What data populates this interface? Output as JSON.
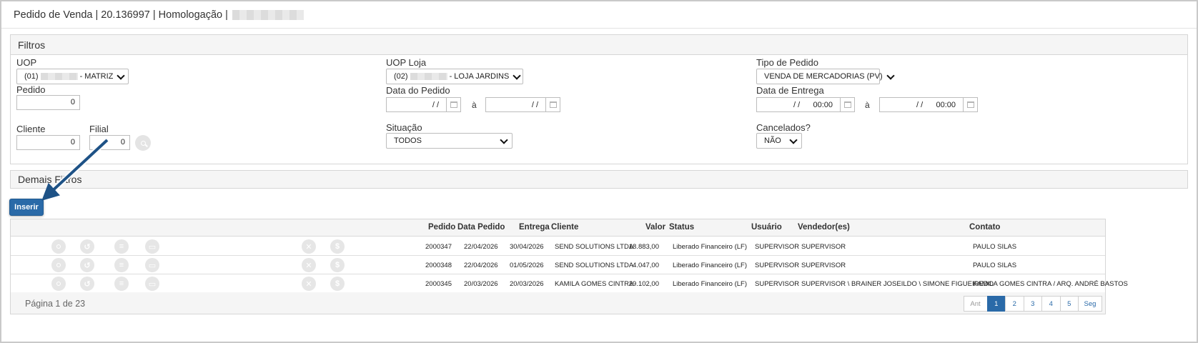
{
  "title": {
    "prefix": "Pedido de Venda | 20.136997 | Homologação |"
  },
  "filters": {
    "header": "Filtros",
    "uop": {
      "label": "UOP",
      "prefix": "(01)",
      "suffix": "- MATRIZ"
    },
    "uop_loja": {
      "label": "UOP Loja",
      "prefix": "(02)",
      "suffix": "- LOJA JARDINS"
    },
    "tipo_pedido": {
      "label": "Tipo de Pedido",
      "value": "VENDA DE MERCADORIAS (PV)"
    },
    "pedido": {
      "label": "Pedido",
      "value": "0"
    },
    "data_pedido": {
      "label": "Data do Pedido",
      "from": "/ /",
      "sep": "à",
      "to": "/ /"
    },
    "data_entrega": {
      "label": "Data de Entrega",
      "from": "/ /      00:00",
      "sep": "à",
      "to": "/ /      00:00"
    },
    "cliente": {
      "label": "Cliente",
      "value": "0"
    },
    "filial": {
      "label": "Filial",
      "value": "0"
    },
    "situacao": {
      "label": "Situação",
      "value": "TODOS"
    },
    "cancelados": {
      "label": "Cancelados?",
      "value": "NÃO"
    }
  },
  "demais_filtros": {
    "header": "Demais Filtros"
  },
  "actions": {
    "inserir": "Inserir"
  },
  "grid": {
    "columns": {
      "pedido": "Pedido",
      "data_pedido": "Data Pedido",
      "entrega": "Entrega",
      "cliente": "Cliente",
      "valor": "Valor",
      "status": "Status",
      "usuario": "Usuário",
      "vendedores": "Vendedor(es)",
      "contato": "Contato"
    },
    "rows": [
      {
        "pedido": "2000347",
        "data_pedido": "22/04/2026",
        "entrega": "30/04/2026",
        "cliente": "SEND SOLUTIONS LTDA",
        "valor": "18.883,00",
        "status": "Liberado Financeiro (LF)",
        "usuario": "SUPERVISOR",
        "vendedores": "SUPERVISOR",
        "contato": "PAULO SILAS"
      },
      {
        "pedido": "2000348",
        "data_pedido": "22/04/2026",
        "entrega": "01/05/2026",
        "cliente": "SEND SOLUTIONS LTDA",
        "valor": "4.047,00",
        "status": "Liberado Financeiro (LF)",
        "usuario": "SUPERVISOR",
        "vendedores": "SUPERVISOR",
        "contato": "PAULO SILAS"
      },
      {
        "pedido": "2000345",
        "data_pedido": "20/03/2026",
        "entrega": "20/03/2026",
        "cliente": "KAMILA GOMES CINTRA",
        "valor": "29.102,00",
        "status": "Liberado Financeiro (LF)",
        "usuario": "SUPERVISOR",
        "vendedores": "SUPERVISOR \\ BRAINER JOSEILDO \\ SIMONE FIGUEIREDO",
        "contato": "KAMILA GOMES CINTRA / ARQ. ANDRÉ BASTOS"
      }
    ],
    "row_icons": [
      "search-icon",
      "history-icon",
      "list-icon",
      "print-icon",
      "cancel-icon",
      "dollar-icon"
    ],
    "footer": {
      "page_info": "Página 1 de 23",
      "pager": [
        "Ant",
        "1",
        "2",
        "3",
        "4",
        "5",
        "Seg"
      ],
      "active_page": "1"
    }
  },
  "colors": {
    "primary": "#2a6aa8",
    "arrow": "#1e5286"
  }
}
